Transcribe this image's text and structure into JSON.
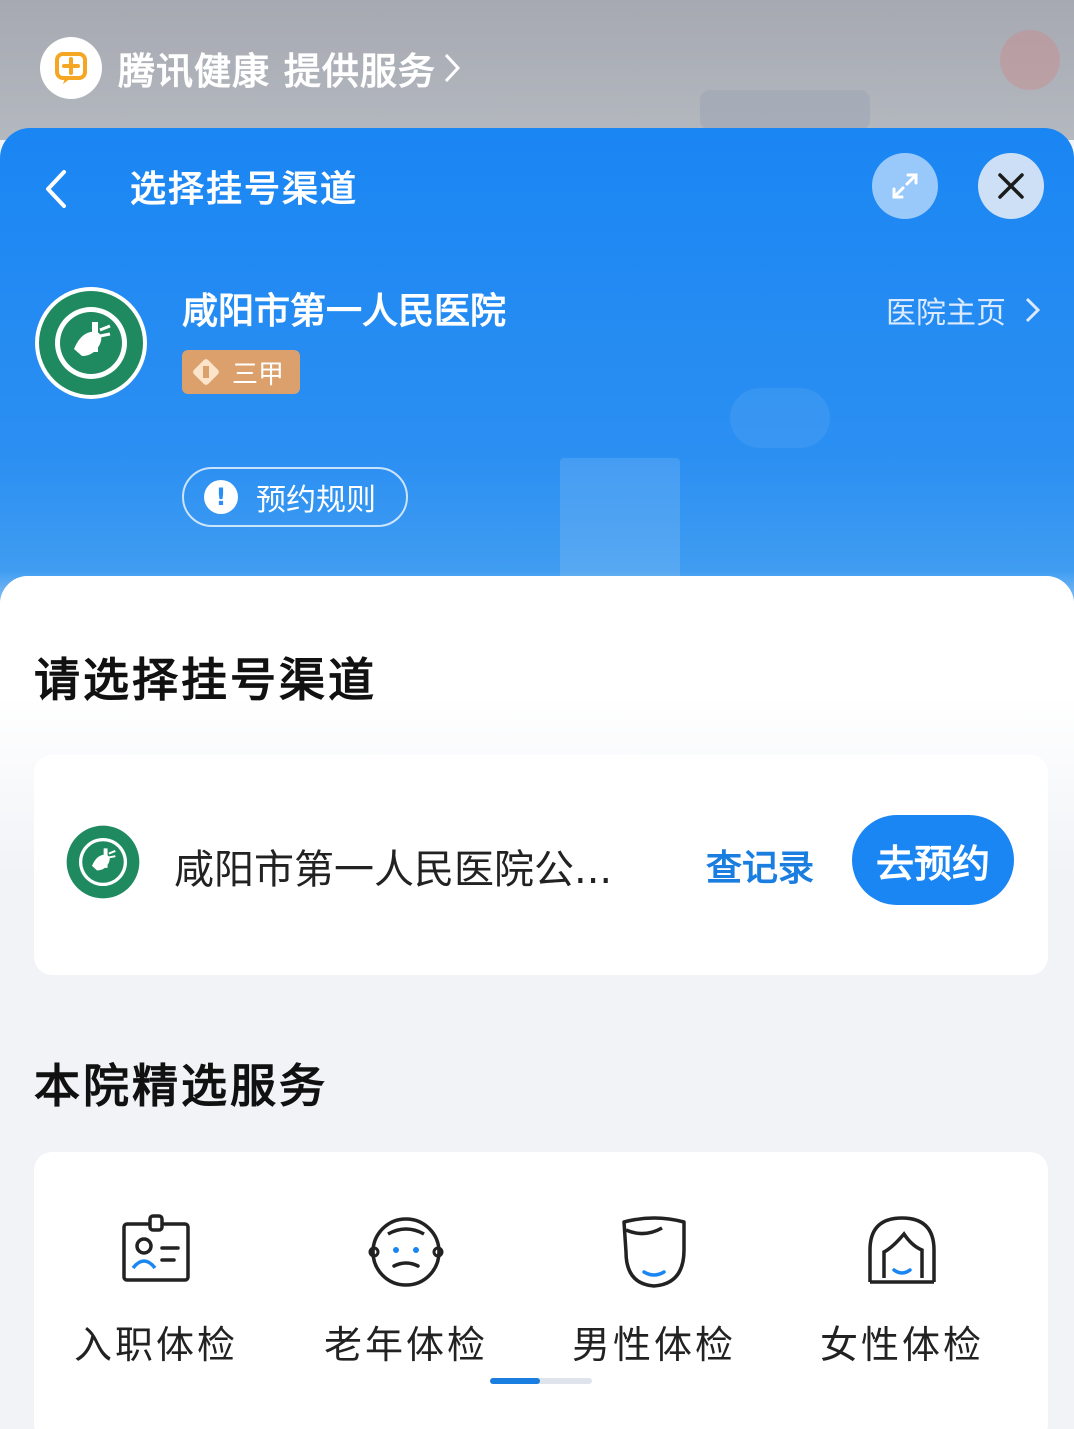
{
  "provider": {
    "name": "腾讯健康 提供服务"
  },
  "nav": {
    "title": "选择挂号渠道"
  },
  "hospital": {
    "name": "咸阳市第一人民医院",
    "grade": "三甲",
    "home_link": "医院主页",
    "rules_label": "预约规则"
  },
  "channels": {
    "title": "请选择挂号渠道",
    "items": [
      {
        "name": "咸阳市第一人民医院公...",
        "record_label": "查记录",
        "book_label": "去预约"
      }
    ]
  },
  "services": {
    "title": "本院精选服务",
    "items": [
      {
        "label": "入职体检",
        "icon": "id-card-icon"
      },
      {
        "label": "老年体检",
        "icon": "elder-face-icon"
      },
      {
        "label": "男性体检",
        "icon": "male-face-icon"
      },
      {
        "label": "女性体检",
        "icon": "female-face-icon"
      }
    ],
    "pager": {
      "pages": 2,
      "current": 1
    }
  },
  "colors": {
    "primary": "#1a86f3",
    "badge": "#dba06c",
    "link": "#1a7de0",
    "logo_green": "#1f8a5f"
  }
}
